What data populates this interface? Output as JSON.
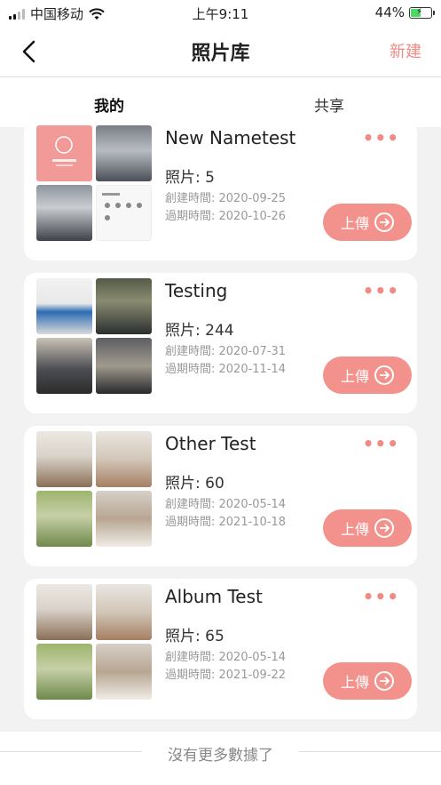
{
  "status": {
    "carrier": "中国移动",
    "time": "上午9:11",
    "battery": "44%",
    "battery_level": 0.44
  },
  "nav": {
    "title": "照片库",
    "new_label": "新建"
  },
  "tabs": [
    {
      "label": "我的",
      "active": true
    },
    {
      "label": "共享",
      "active": false
    }
  ],
  "albums": [
    {
      "name": "New Nametest",
      "count": "照片: 5",
      "created": "創建時間: 2020-09-25",
      "expire": "過期時間: 2020-10-26",
      "upload_label": "上傳",
      "more": "•••"
    },
    {
      "name": "Testing",
      "count": "照片: 244",
      "created": "創建時間: 2020-07-31",
      "expire": "過期時間: 2020-11-14",
      "upload_label": "上傳",
      "more": "•••"
    },
    {
      "name": "Other Test",
      "count": "照片: 60",
      "created": "創建時間: 2020-05-14",
      "expire": "過期時間: 2021-10-18",
      "upload_label": "上傳",
      "more": "•••"
    },
    {
      "name": "Album Test",
      "count": "照片: 65",
      "created": "創建時間: 2020-05-14",
      "expire": "過期時間: 2021-09-22",
      "upload_label": "上傳",
      "more": "•••"
    }
  ],
  "footer": {
    "text": "沒有更多數據了"
  },
  "colors": {
    "accent": "#f3928c",
    "tab_indicator": "#e0413f",
    "new_text": "#f08a85"
  }
}
